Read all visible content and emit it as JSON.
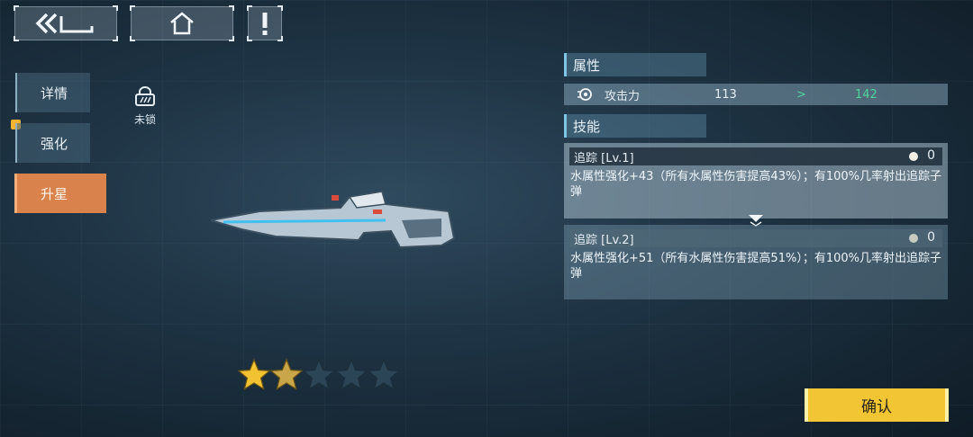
{
  "nav": {
    "back_icon": "double-chevron-back-icon",
    "home_icon": "home-icon",
    "alert_icon": "exclamation-icon"
  },
  "tabs": [
    {
      "label": "详情"
    },
    {
      "label": "强化"
    },
    {
      "label": "升星"
    }
  ],
  "lock": {
    "label": "未锁",
    "icon": "lock-icon"
  },
  "attributes": {
    "header": "属性",
    "rows": [
      {
        "icon": "attack-icon",
        "name": "攻击力",
        "current": "113",
        "arrow": ">",
        "next": "142"
      }
    ]
  },
  "skills": {
    "header": "技能",
    "items": [
      {
        "title": "追踪 [Lv.1]",
        "count": "0",
        "description": "水属性强化+43（所有水属性伤害提高43%）；有100%几率射出追踪子弹"
      },
      {
        "title": "追踪 [Lv.2]",
        "count": "0",
        "description": "水属性强化+51（所有水属性伤害提高51%）；有100%几率射出追踪子弹"
      }
    ]
  },
  "weapon": {
    "icon": "sniper-rifle-icon"
  },
  "stars": {
    "filled": 2,
    "total": 5,
    "colors": {
      "gold": "#f2c233",
      "bronze": "#c9a64a",
      "empty": "#2c4556"
    }
  },
  "confirm": {
    "label": "确认"
  },
  "colors": {
    "active_tab": "#d9824b",
    "confirm": "#f1c533",
    "next_value": "#4fd39c",
    "accent": "#7fc5e6"
  }
}
